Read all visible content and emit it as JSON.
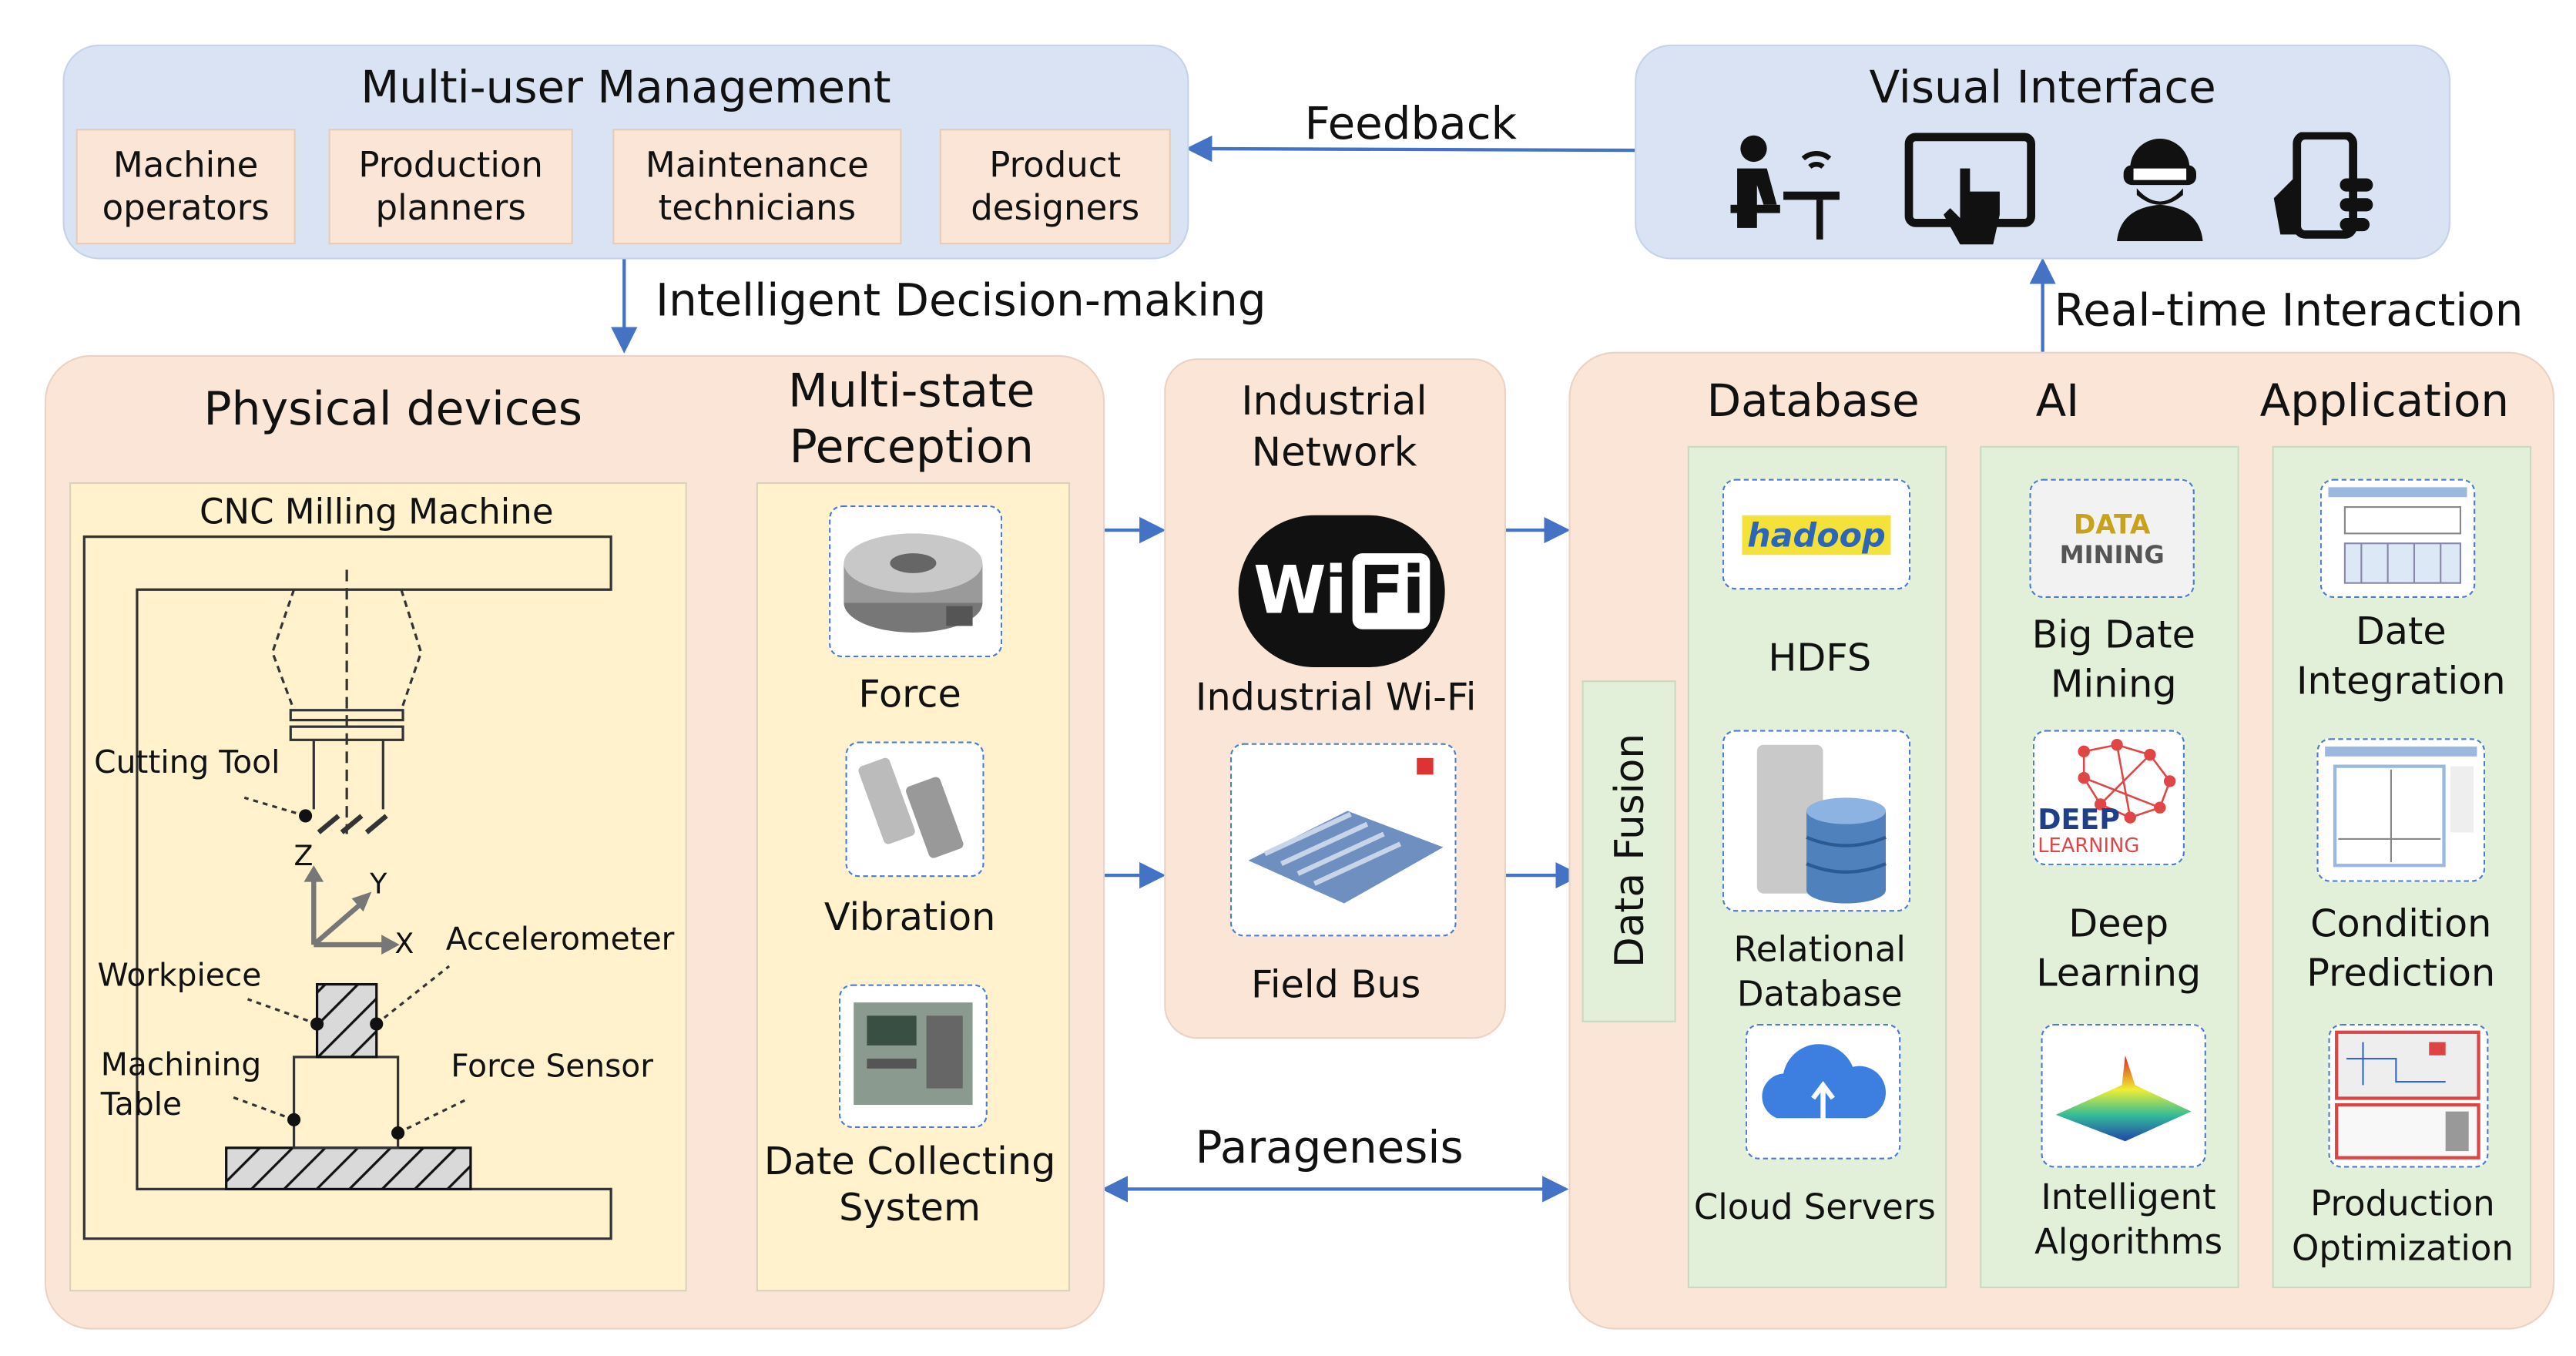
{
  "multi_user": {
    "title": "Multi-user Management",
    "roles": [
      "Machine operators",
      "Production planners",
      "Maintenance technicians",
      "Product designers"
    ]
  },
  "visual_interface": {
    "title": "Visual Interface",
    "icons": [
      "operator-at-desk-icon",
      "tablet-touch-icon",
      "vr-user-icon",
      "smartphone-hand-icon"
    ]
  },
  "arrows": {
    "feedback": "Feedback",
    "decision": "Intelligent Decision-making",
    "realtime": "Real-time Interaction",
    "paragenesis": "Paragenesis"
  },
  "physical": {
    "title": "Physical devices",
    "machine": "CNC Milling Machine",
    "labels": {
      "cutting_tool": "Cutting Tool",
      "workpiece": "Workpiece",
      "accelerometer": "Accelerometer",
      "machining_table": "Machining Table",
      "force_sensor": "Force Sensor",
      "z": "Z",
      "y": "Y",
      "x": "X"
    }
  },
  "perception": {
    "title": "Multi-state Perception",
    "items": [
      "Force",
      "Vibration",
      "Date Collecting System"
    ]
  },
  "network": {
    "title": "Industrial Network",
    "wifi_logo": "Wi Fi",
    "items": [
      "Industrial Wi-Fi",
      "Field Bus"
    ]
  },
  "platform": {
    "data_fusion": "Data Fusion",
    "database": {
      "title": "Database",
      "items": [
        "HDFS",
        "Relational Database",
        "Cloud Servers"
      ],
      "hdfs_logo": "hadoop HDFS"
    },
    "ai": {
      "title": "AI",
      "items": [
        "Big Date Mining",
        "Deep Learning",
        "Intelligent Algorithms"
      ],
      "deep_logo": [
        "DEEP",
        "LEARNING"
      ],
      "mining_logo": [
        "DATA",
        "MINING"
      ]
    },
    "application": {
      "title": "Application",
      "items": [
        "Date Integration",
        "Condition Prediction",
        "Production Optimization"
      ]
    }
  },
  "colors": {
    "arrow": "#4472c4",
    "blue_panel": "#dae3f3",
    "peach_panel": "#fbe5d6",
    "yellow_panel": "#fff2cc",
    "green_panel": "#e2f0d9"
  }
}
